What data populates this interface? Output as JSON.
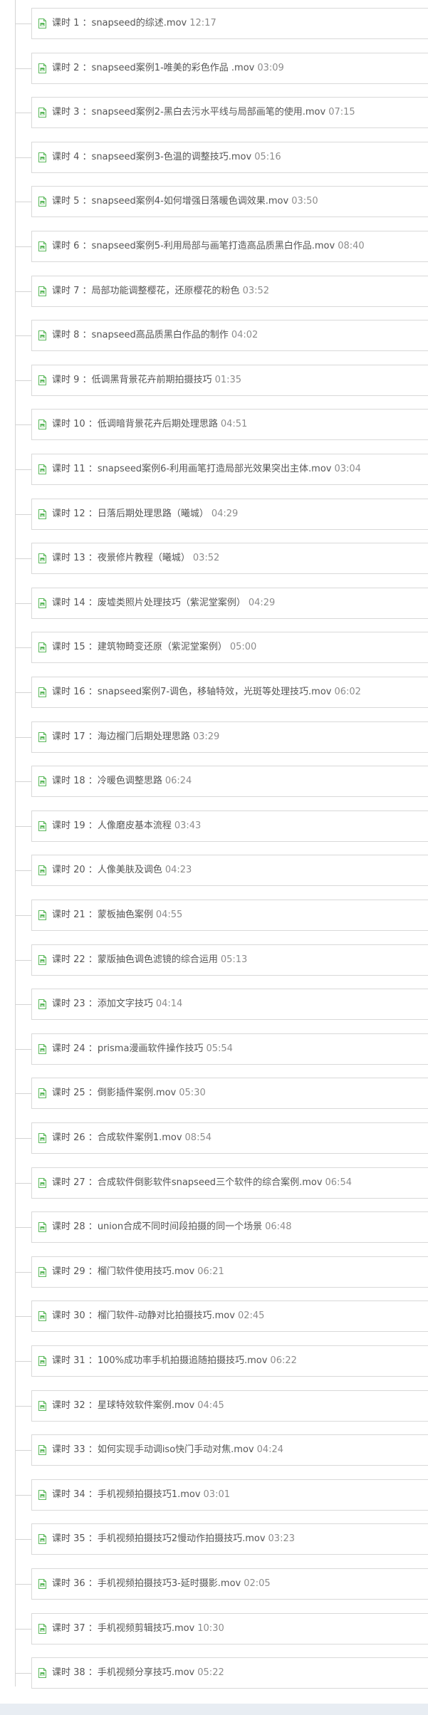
{
  "lessons": [
    {
      "label": "课时 1 ：",
      "title": "snapseed的综述.mov",
      "duration": "12:17"
    },
    {
      "label": "课时 2 ：",
      "title": "snapseed案例1-唯美的彩色作品 .mov",
      "duration": "03:09"
    },
    {
      "label": "课时 3 ：",
      "title": "snapseed案例2-黑白去污水平线与局部画笔的使用.mov",
      "duration": "07:15"
    },
    {
      "label": "课时 4 ：",
      "title": "snapseed案例3-色温的调整技巧.mov",
      "duration": "05:16"
    },
    {
      "label": "课时 5 ：",
      "title": "snapseed案例4-如何增强日落暖色调效果.mov",
      "duration": "03:50"
    },
    {
      "label": "课时 6 ：",
      "title": "snapseed案例5-利用局部与画笔打造高品质黑白作品.mov",
      "duration": "08:40"
    },
    {
      "label": "课时 7 ：",
      "title": "局部功能调整樱花，还原樱花的粉色",
      "duration": "03:52"
    },
    {
      "label": "课时 8 ：",
      "title": "snapseed高品质黑白作品的制作",
      "duration": "04:02"
    },
    {
      "label": "课时 9 ：",
      "title": "低调黑背景花卉前期拍摄技巧",
      "duration": "01:35"
    },
    {
      "label": "课时 10 ：",
      "title": "低调暗背景花卉后期处理思路",
      "duration": "04:51"
    },
    {
      "label": "课时 11 ：",
      "title": "snapseed案例6-利用画笔打造局部光效果突出主体.mov",
      "duration": "03:04"
    },
    {
      "label": "课时 12 ：",
      "title": "日落后期处理思路（曦城）",
      "duration": "04:29"
    },
    {
      "label": "课时 13 ：",
      "title": "夜景修片教程（曦城）",
      "duration": "03:52"
    },
    {
      "label": "课时 14 ：",
      "title": "废墟类照片处理技巧（紫泥堂案例）",
      "duration": "04:29"
    },
    {
      "label": "课时 15 ：",
      "title": "建筑物畸变还原（紫泥堂案例）",
      "duration": "05:00"
    },
    {
      "label": "课时 16 ：",
      "title": "snapseed案例7-调色，移轴特效，光斑等处理技巧.mov",
      "duration": "06:02"
    },
    {
      "label": "课时 17 ：",
      "title": "海边榴门后期处理思路",
      "duration": "03:29"
    },
    {
      "label": "课时 18 ：",
      "title": "冷暖色调整思路",
      "duration": "06:24"
    },
    {
      "label": "课时 19 ：",
      "title": "人像磨皮基本流程",
      "duration": "03:43"
    },
    {
      "label": "课时 20 ：",
      "title": "人像美肤及调色",
      "duration": "04:23"
    },
    {
      "label": "课时 21 ：",
      "title": "蒙板抽色案例",
      "duration": "04:55"
    },
    {
      "label": "课时 22 ：",
      "title": "蒙版抽色调色滤镜的综合运用",
      "duration": "05:13"
    },
    {
      "label": "课时 23 ：",
      "title": "添加文字技巧",
      "duration": "04:14"
    },
    {
      "label": "课时 24 ：",
      "title": "prisma漫画软件操作技巧",
      "duration": "05:54"
    },
    {
      "label": "课时 25 ：",
      "title": "倒影插件案例.mov",
      "duration": "05:30"
    },
    {
      "label": "课时 26 ：",
      "title": "合成软件案例1.mov",
      "duration": "08:54"
    },
    {
      "label": "课时 27 ：",
      "title": "合成软件倒影软件snapseed三个软件的综合案例.mov",
      "duration": "06:54"
    },
    {
      "label": "课时 28 ：",
      "title": "union合成不同时间段拍摄的同一个场景",
      "duration": "06:48"
    },
    {
      "label": "课时 29 ：",
      "title": "榴门软件使用技巧.mov",
      "duration": "06:21"
    },
    {
      "label": "课时 30 ：",
      "title": "榴门软件-动静对比拍摄技巧.mov",
      "duration": "02:45"
    },
    {
      "label": "课时 31 ：",
      "title": "100%成功率手机拍摄追随拍摄技巧.mov",
      "duration": "06:22"
    },
    {
      "label": "课时 32 ：",
      "title": "星球特效软件案例.mov",
      "duration": "04:45"
    },
    {
      "label": "课时 33 ：",
      "title": "如何实现手动调iso快门手动对焦.mov",
      "duration": "04:24"
    },
    {
      "label": "课时 34 ：",
      "title": "手机视频拍摄技巧1.mov",
      "duration": "03:01"
    },
    {
      "label": "课时 35 ：",
      "title": "手机视频拍摄技巧2慢动作拍摄技巧.mov",
      "duration": "03:23"
    },
    {
      "label": "课时 36 ：",
      "title": "手机视频拍摄技巧3-延时摄影.mov",
      "duration": "02:05"
    },
    {
      "label": "课时 37 ：",
      "title": "手机视频剪辑技巧.mov",
      "duration": "10:30"
    },
    {
      "label": "课时 38 ：",
      "title": "手机视频分享技巧.mov",
      "duration": "05:22"
    }
  ],
  "icon": {
    "name": "file-icon",
    "color": "#5cb85c"
  },
  "colors": {
    "text": "#555555",
    "duration": "#8c8c8c",
    "border": "#d9d9d9",
    "footer": "#e8edf3"
  }
}
